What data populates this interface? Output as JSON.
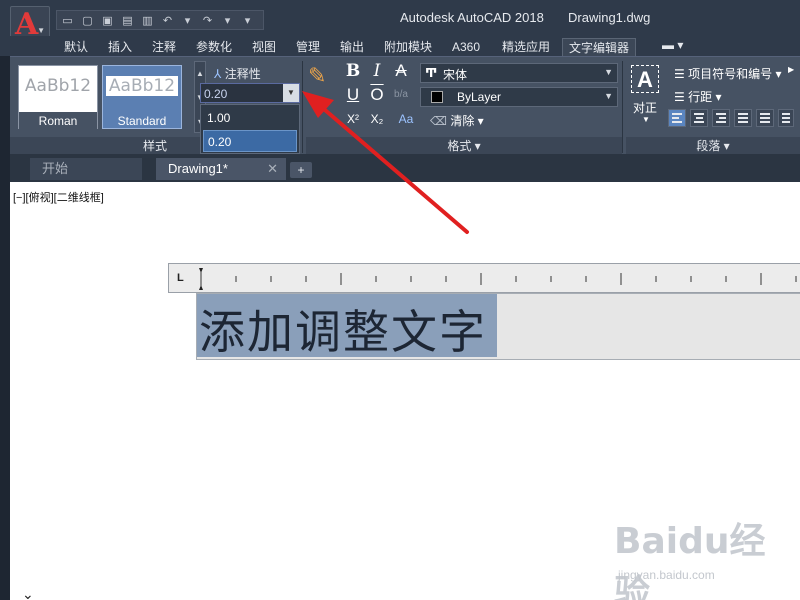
{
  "app": {
    "logo_letter": "A",
    "title": "Autodesk AutoCAD 2018",
    "document_name": "Drawing1.dwg"
  },
  "ribbon_tabs": [
    "默认",
    "插入",
    "注释",
    "参数化",
    "视图",
    "管理",
    "输出",
    "附加模块",
    "A360",
    "精选应用",
    "文字编辑器"
  ],
  "style_panel": {
    "swatches": [
      {
        "sample": "AaBb12",
        "name": "Roman"
      },
      {
        "sample": "AaBb12",
        "name": "Standard"
      }
    ],
    "annotative_label": "注释性",
    "text_height_value": "0.20",
    "height_options": [
      "1.00",
      "0.20"
    ],
    "footer": "样式"
  },
  "format_panel": {
    "bold": "B",
    "italic": "I",
    "strike": "A",
    "underline": "U",
    "overline": "O",
    "font": "宋体",
    "color": "ByLayer",
    "superscript": "X²",
    "subscript": "X₂",
    "case": "Aa",
    "clear": "清除",
    "footer": "格式"
  },
  "paragraph_panel": {
    "justify_label": "对正",
    "bullets_label": "项目符号和编号",
    "line_spacing_label": "行距",
    "footer": "段落"
  },
  "doc_tabs": {
    "start": "开始",
    "drawing": "Drawing1*",
    "close_glyph": "✕",
    "add_glyph": "+"
  },
  "viewport_label": "[−][俯视][二维线框]",
  "editor_text": "添加调整文字",
  "watermark": {
    "brand": "Baidu经验",
    "url": "jingyan.baidu.com"
  },
  "colors": {
    "selection": "#8a9fba",
    "ribbon": "#465263",
    "arrow": "#e02020"
  }
}
